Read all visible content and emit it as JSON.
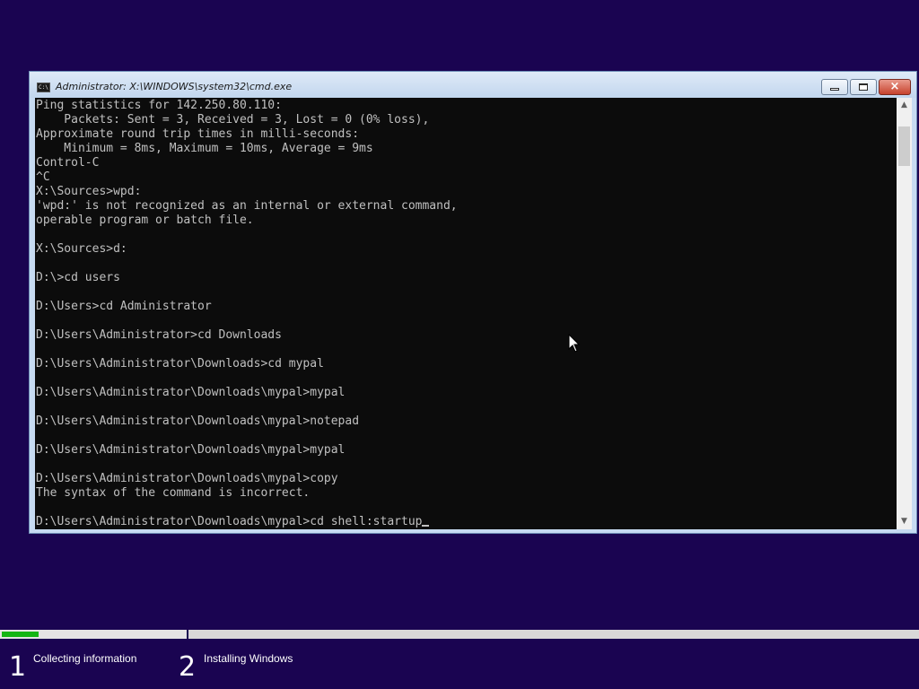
{
  "window": {
    "title": "Administrator: X:\\WINDOWS\\system32\\cmd.exe",
    "icon_label": "C:\\",
    "minimize": "minimize-icon",
    "maximize": "maximize-icon",
    "close": "×"
  },
  "console": {
    "lines": [
      "Ping statistics for 142.250.80.110:",
      "    Packets: Sent = 3, Received = 3, Lost = 0 (0% loss),",
      "Approximate round trip times in milli-seconds:",
      "    Minimum = 8ms, Maximum = 10ms, Average = 9ms",
      "Control-C",
      "^C",
      "X:\\Sources>wpd:",
      "'wpd:' is not recognized as an internal or external command,",
      "operable program or batch file.",
      "",
      "X:\\Sources>d:",
      "",
      "D:\\>cd users",
      "",
      "D:\\Users>cd Administrator",
      "",
      "D:\\Users\\Administrator>cd Downloads",
      "",
      "D:\\Users\\Administrator\\Downloads>cd mypal",
      "",
      "D:\\Users\\Administrator\\Downloads\\mypal>mypal",
      "",
      "D:\\Users\\Administrator\\Downloads\\mypal>notepad",
      "",
      "D:\\Users\\Administrator\\Downloads\\mypal>mypal",
      "",
      "D:\\Users\\Administrator\\Downloads\\mypal>copy",
      "The syntax of the command is incorrect.",
      "",
      "D:\\Users\\Administrator\\Downloads\\mypal>cd shell:startup"
    ],
    "colors": {
      "background": "#0c0c0c",
      "text": "#c0c0c0"
    }
  },
  "scrollbar": {
    "up_icon": "▲",
    "down_icon": "▼"
  },
  "setup": {
    "progress_fraction": 0.04,
    "steps": [
      {
        "number": "1",
        "label": "Collecting information"
      },
      {
        "number": "2",
        "label": "Installing Windows"
      }
    ],
    "colors": {
      "background": "#1a0451",
      "progress": "#14b514"
    }
  }
}
